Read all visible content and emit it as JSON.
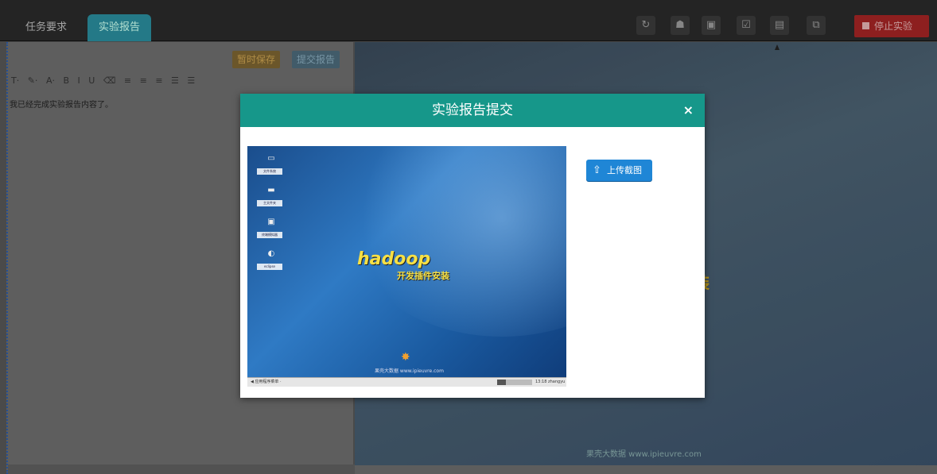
{
  "tabs": [
    {
      "label": "任务要求"
    },
    {
      "label": "实验报告"
    }
  ],
  "toolbar": {
    "icons": [
      "refresh-icon",
      "user-icon",
      "fullscreen-icon",
      "checklist-icon",
      "report-icon",
      "copy-icon"
    ],
    "stop_label": "停止实验"
  },
  "editor": {
    "save_label": "暂时保存",
    "submit_label": "提交报告",
    "toolbar_items": [
      "T·",
      "✎·",
      "A·",
      "B",
      "I",
      "U",
      "⌫",
      "≡",
      "≡",
      "≡",
      "☰",
      "☰"
    ],
    "content": "我已经完成实验报告内容了。"
  },
  "modal": {
    "title": "实验报告提交",
    "close": "×",
    "upload_label": "上传截图",
    "screenshot": {
      "desktop_icons": [
        "文件系统",
        "主文件夹",
        "终端模拟器",
        "eclipse"
      ],
      "title_text": "hadoop",
      "subtitle_text": "开发插件安装",
      "watermark": "果壳大数据 www.ipieuvre.com",
      "taskbar_left": "◀ 应用程序菜单 ·",
      "taskbar_time": "13:18  zhangyu"
    }
  },
  "background": {
    "hadoop_text": "装",
    "watermark": "果壳大数据 www.ipieuvre.com"
  },
  "colors": {
    "modal_header": "#16978a",
    "upload_button": "#1f86d6",
    "stop_button": "#a12424"
  }
}
